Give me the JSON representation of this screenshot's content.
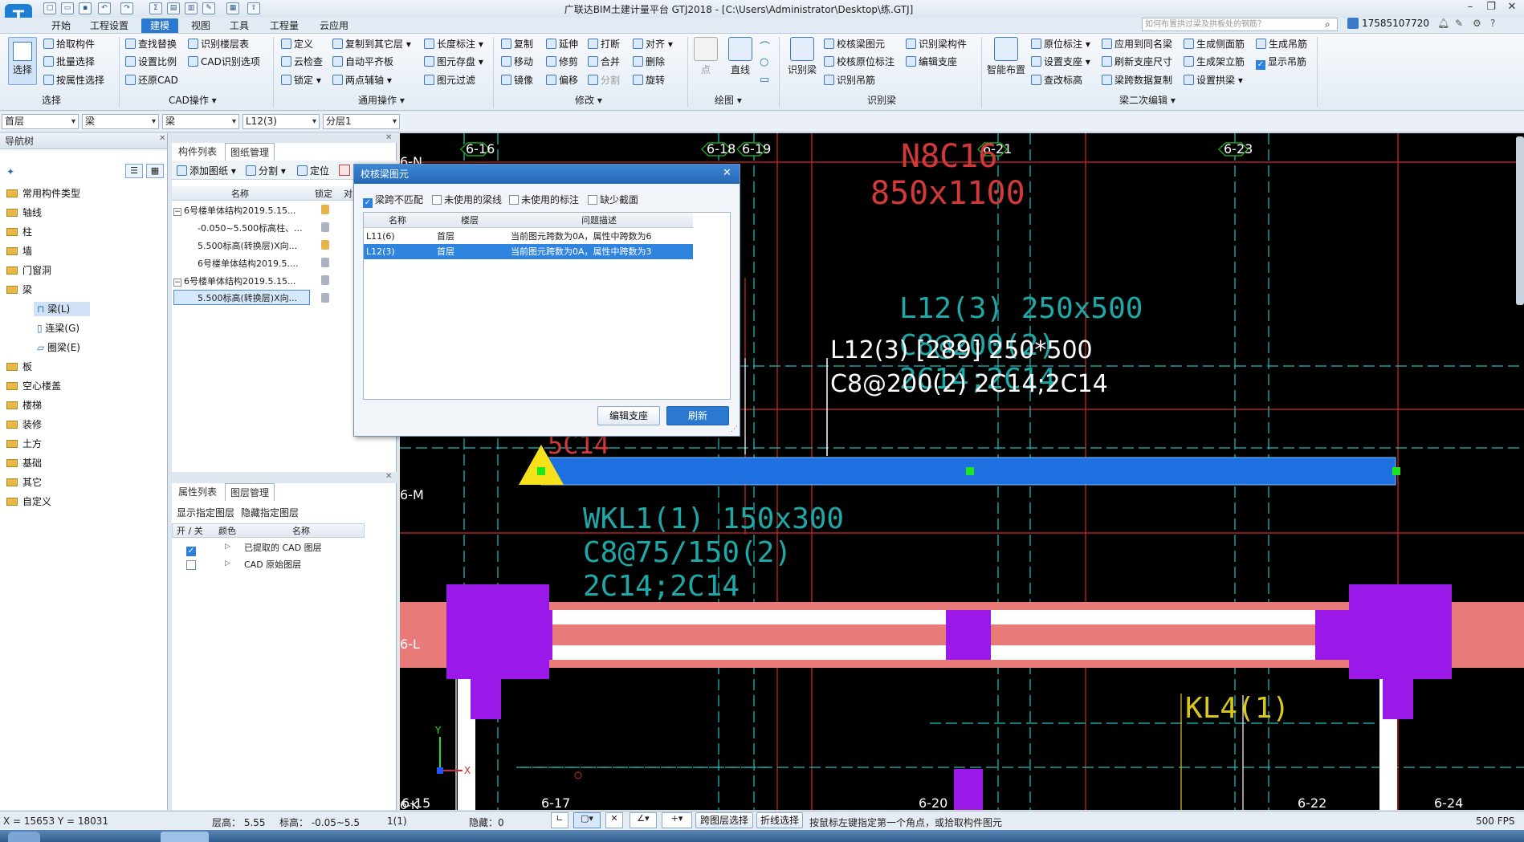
{
  "app": {
    "title": "广联达BIM土建计量平台 GTJ2018 - [C:\\Users\\Administrator\\Desktop\\练.GTJ]",
    "logo": "T"
  },
  "menus": [
    "开始",
    "工程设置",
    "建模",
    "视图",
    "工具",
    "工程量",
    "云应用"
  ],
  "active_menu": "建模",
  "search_placeholder": "如何布置拱过梁及拱板处的钢筋？",
  "user_phone": "17585107720",
  "ribbon": {
    "select": {
      "big": "选择",
      "items": [
        "拾取构件",
        "批量选择",
        "按属性选择"
      ],
      "group": "选择"
    },
    "cad": {
      "items": [
        "查找替换",
        "识别楼层表",
        "设置比例",
        "CAD识别选项",
        "还原CAD"
      ],
      "group": "CAD操作"
    },
    "general": {
      "items": [
        "定义",
        "复制到其它层",
        "长度标注",
        "云检查",
        "自动平齐板",
        "图元存盘",
        "锁定",
        "两点辅轴",
        "图元过滤"
      ],
      "group": "通用操作"
    },
    "modify": {
      "items": [
        "复制",
        "延伸",
        "打断",
        "对齐",
        "移动",
        "修剪",
        "合并",
        "删除",
        "镜像",
        "偏移",
        "分割",
        "旋转"
      ],
      "group": "修改"
    },
    "draw": {
      "items": [
        "点",
        "直线"
      ],
      "group": "绘图"
    },
    "recognize": {
      "big": "识别梁",
      "items": [
        "校核梁图元",
        "识别梁构件",
        "校核原位标注",
        "编辑支座",
        "识别吊筋"
      ],
      "group": "识别梁"
    },
    "beam2": {
      "big": "智能布置",
      "items": [
        "原位标注",
        "应用到同名梁",
        "生成侧面筋",
        "生成吊筋",
        "设置支座",
        "刷新支座尺寸",
        "生成架立筋",
        "显示吊筋",
        "查改标高",
        "梁跨数据复制",
        "设置拱梁"
      ],
      "group": "梁二次编辑"
    }
  },
  "toolbar_combos": [
    "首层",
    "梁",
    "梁",
    "L12(3)",
    "分层1"
  ],
  "nav": {
    "title": "导航树",
    "items": [
      "常用构件类型",
      "轴线",
      "柱",
      "墙",
      "门窗洞",
      "梁",
      "板",
      "空心楼盖",
      "楼梯",
      "装修",
      "土方",
      "基础",
      "其它",
      "自定义"
    ],
    "beam_children": [
      "梁(L)",
      "连梁(G)",
      "圈梁(E)"
    ]
  },
  "drawing_panel": {
    "tabs": [
      "构件列表",
      "图纸管理"
    ],
    "toolbar": [
      "添加图纸",
      "分割",
      "定位"
    ],
    "columns": [
      "名称",
      "锁定",
      "对"
    ],
    "rows": [
      "6号楼单体结构2019.5.15...",
      "-0.050~5.500标高柱、...",
      "5.500标高(转换层)X向...",
      "6号楼单体结构2019.5....",
      "6号楼单体结构2019.5.15...",
      "5.500标高(转换层)X向..."
    ]
  },
  "layer_panel": {
    "tabs": [
      "属性列表",
      "图层管理"
    ],
    "actions": [
      "显示指定图层",
      "隐藏指定图层"
    ],
    "columns": [
      "开 / 关",
      "颜色",
      "名称"
    ],
    "rows": [
      {
        "name": "已提取的 CAD 图层",
        "on": true
      },
      {
        "name": "CAD 原始图层",
        "on": false
      }
    ]
  },
  "dialog": {
    "title": "校核梁图元",
    "filters": [
      {
        "label": "梁跨不匹配",
        "on": true
      },
      {
        "label": "未使用的梁线",
        "on": false
      },
      {
        "label": "未使用的标注",
        "on": false
      },
      {
        "label": "缺少截面",
        "on": false
      }
    ],
    "columns": [
      "名称",
      "楼层",
      "问题描述"
    ],
    "rows": [
      {
        "name": "L11(6)",
        "floor": "首层",
        "desc": "当前图元跨数为0A，属性中跨数为6"
      },
      {
        "name": "L12(3)",
        "floor": "首层",
        "desc": "当前图元跨数为0A，属性中跨数为3"
      }
    ],
    "buttons": [
      "编辑支座",
      "刷新"
    ]
  },
  "canvas": {
    "axes_top": [
      "6-16",
      "6-18",
      "6-19",
      "6-21",
      "6-23"
    ],
    "axes_bottom": [
      "6-15",
      "6-17",
      "6-20",
      "6-22",
      "6-24"
    ],
    "axes_left": [
      "6-N",
      "6-M",
      "6-L",
      "6-K"
    ],
    "cad_texts": [
      "N8C16",
      "850x1100",
      "L12(3) 250x500",
      "C8@200(2)",
      "2C14;2C14",
      "5C14",
      "WKL1(1) 150x300",
      "C8@75/150(2)",
      "2C14;2C14",
      "KL4(1)"
    ],
    "tooltip_line1": "L12(3) [289] 250*500",
    "tooltip_line2": "C8@200(2) 2C14;2C14",
    "axis_x": "X",
    "axis_y": "Y"
  },
  "status": {
    "coords": "X = 15653 Y = 18031",
    "floor_height": "层高： 5.55",
    "elevation": "标高： -0.05~5.5",
    "count": "1(1)",
    "hidden": "隐藏：0",
    "btn1": "跨图层选择",
    "btn2": "折线选择",
    "hint": "按鼠标左键指定第一个角点，或拾取构件图元",
    "fps": "500 FPS"
  },
  "colors": {
    "accent": "#2b78d0",
    "beam_blue": "#1e6fe0",
    "column_purple": "#9a19e8",
    "cad_cyan": "#1fb6b6",
    "cad_red": "#d23a3a"
  }
}
